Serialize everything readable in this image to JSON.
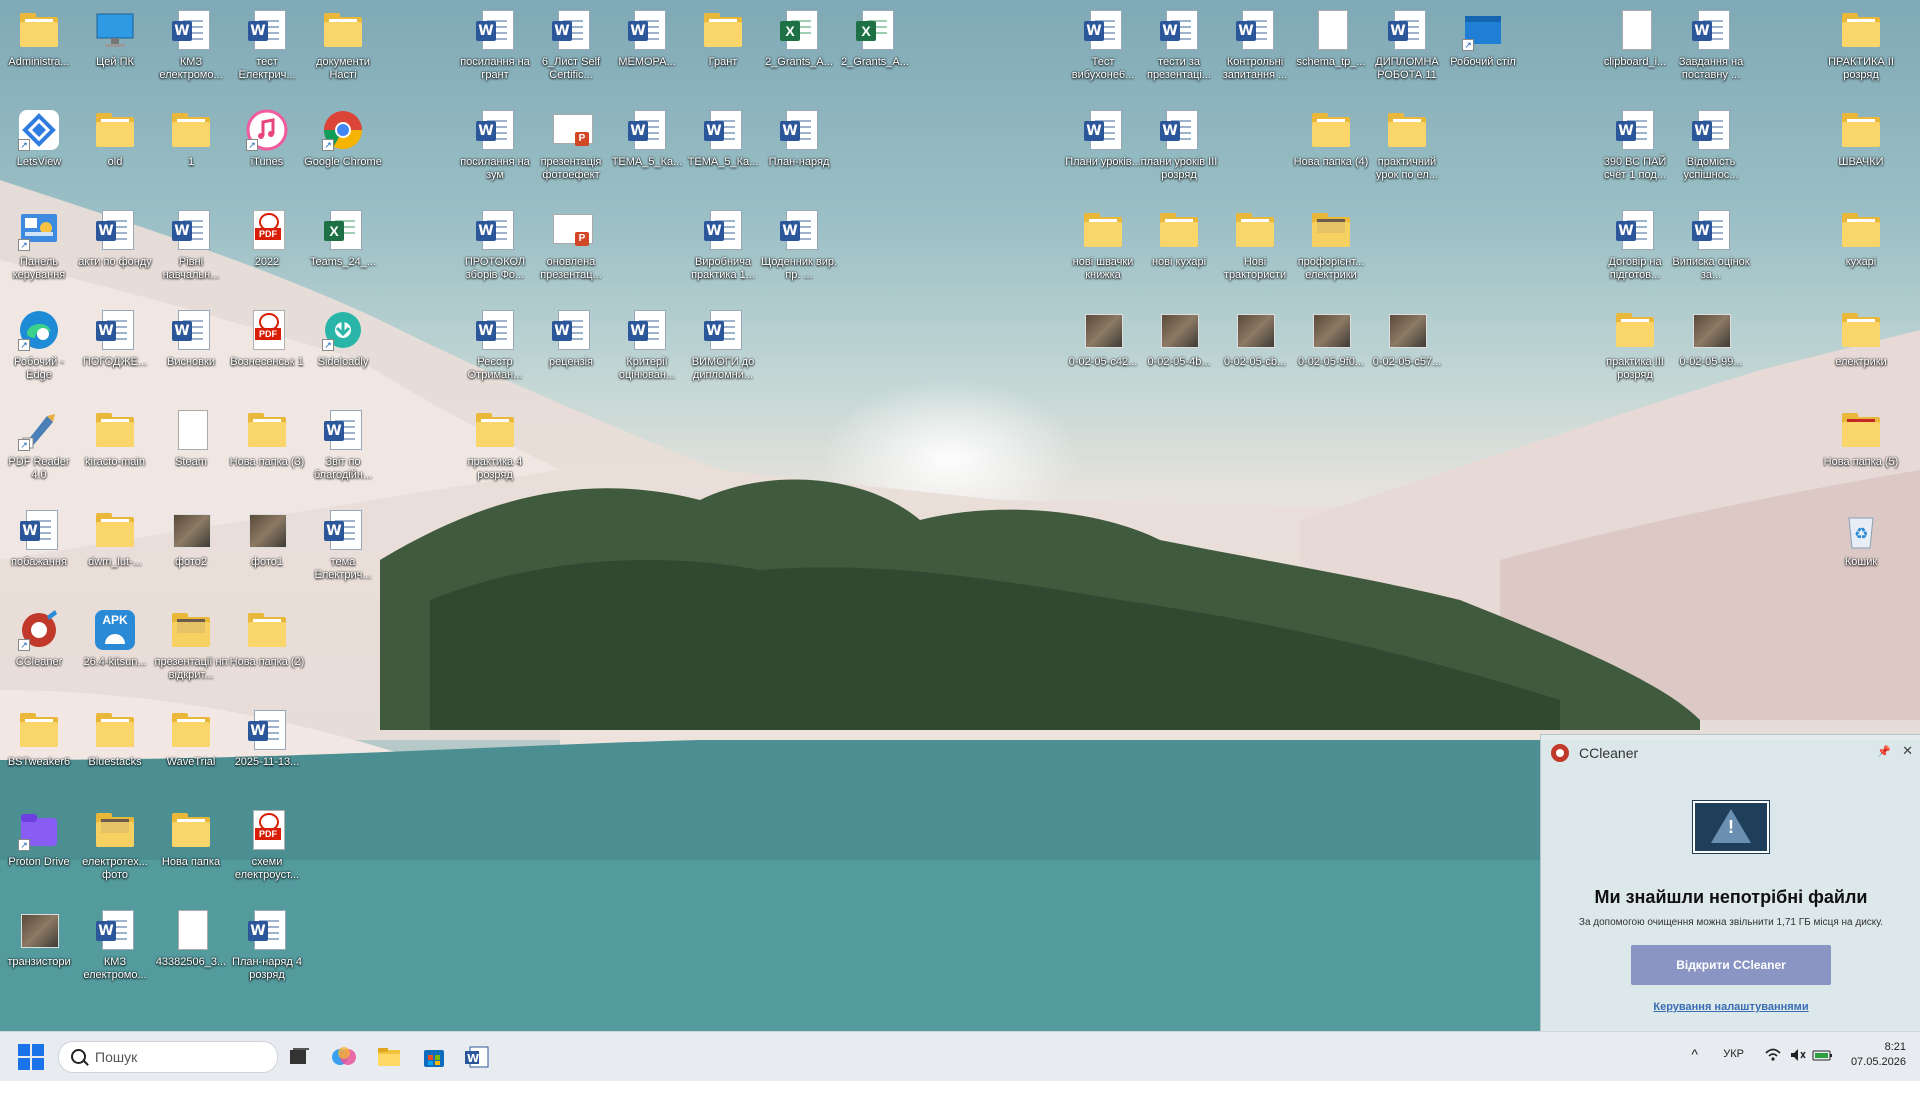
{
  "desktop": {
    "icons": [
      {
        "label": "Administra...",
        "type": "folder"
      },
      {
        "label": "Цей ПК",
        "type": "pc"
      },
      {
        "label": "КМЗ електромо...",
        "type": "word"
      },
      {
        "label": "тест Електрич...",
        "type": "word"
      },
      {
        "label": "документи Насті",
        "type": "folder"
      },
      {
        "label": "посилання на грант",
        "type": "word"
      },
      {
        "label": "6_Лист Self Certific...",
        "type": "word"
      },
      {
        "label": "МЕМОРА...",
        "type": "word"
      },
      {
        "label": "Грант",
        "type": "folder"
      },
      {
        "label": "2_Grants_A...",
        "type": "excel"
      },
      {
        "label": "2_Grants_A...",
        "type": "excel"
      },
      {
        "label": "Тест вибухоне6...",
        "type": "word"
      },
      {
        "label": "тести за презентаці...",
        "type": "word"
      },
      {
        "label": "Контрольні запитання ...",
        "type": "word"
      },
      {
        "label": "schema_tp_...",
        "type": "blank"
      },
      {
        "label": "ДИПЛОМНА РОБОТА.11",
        "type": "word"
      },
      {
        "label": "Робочий стіл",
        "type": "desktopfolder"
      },
      {
        "label": "clipboard_i...",
        "type": "blank"
      },
      {
        "label": "Завдання на поставну ...",
        "type": "word"
      },
      {
        "label": "ПРАКТИКА ІІ розряд",
        "type": "folder"
      },
      {
        "label": "LetsView",
        "type": "letsview"
      },
      {
        "label": "old",
        "type": "folder"
      },
      {
        "label": "1",
        "type": "folder"
      },
      {
        "label": "iTunes",
        "type": "itunes"
      },
      {
        "label": "Google Chrome",
        "type": "chrome"
      },
      {
        "label": "посилання на зум",
        "type": "word"
      },
      {
        "label": "презентація фотоефект",
        "type": "ppt"
      },
      {
        "label": "ТЕМА_5_Ка...",
        "type": "word"
      },
      {
        "label": "ТЕМА_5_Ка...",
        "type": "word"
      },
      {
        "label": "План-наряд",
        "type": "word"
      },
      {
        "label": "Плани уроків...",
        "type": "word"
      },
      {
        "label": "плани уроків ІІІ розряд",
        "type": "word"
      },
      {
        "label": "Нова папка (4)",
        "type": "folder"
      },
      {
        "label": "практичний урок по ел...",
        "type": "folder"
      },
      {
        "label": "390 ВС ПАЙ счёт 1 под...",
        "type": "word"
      },
      {
        "label": "Відомість успішнос...",
        "type": "word"
      },
      {
        "label": "ШВАЧКИ",
        "type": "folder"
      },
      {
        "label": "Панель керування",
        "type": "control"
      },
      {
        "label": "акти по фонду",
        "type": "word"
      },
      {
        "label": "Рівні навчальн...",
        "type": "word"
      },
      {
        "label": "2022",
        "type": "pdf"
      },
      {
        "label": "Teams_24_...",
        "type": "excel"
      },
      {
        "label": "ПРОТОКОЛ зборів Фо...",
        "type": "word"
      },
      {
        "label": "оновлена презентац...",
        "type": "ppt"
      },
      {
        "label": "Виробнича практика 1...",
        "type": "word"
      },
      {
        "label": "Щоденник вир. пр. ...",
        "type": "word"
      },
      {
        "label": "нові швачки книжка",
        "type": "folder"
      },
      {
        "label": "нові кухарі",
        "type": "folder"
      },
      {
        "label": "Нові трактористи",
        "type": "folder"
      },
      {
        "label": "профорієнт... електрики",
        "type": "photofolder"
      },
      {
        "label": "Договір на підготов...",
        "type": "word"
      },
      {
        "label": "Виписка оцінок за...",
        "type": "word"
      },
      {
        "label": "кухарі",
        "type": "folder"
      },
      {
        "label": "Робочий - Edge",
        "type": "edge"
      },
      {
        "label": "ПОГОДЖЕ...",
        "type": "word"
      },
      {
        "label": "Висновки",
        "type": "word"
      },
      {
        "label": "Вознесенськ 1",
        "type": "pdf"
      },
      {
        "label": "Sideloadly",
        "type": "sideloadly"
      },
      {
        "label": "Реєстр Отриман...",
        "type": "word"
      },
      {
        "label": "рецензія",
        "type": "word"
      },
      {
        "label": "Критерії оцінюван...",
        "type": "word"
      },
      {
        "label": "ВИМОГИ до дипломни...",
        "type": "word"
      },
      {
        "label": "0-02-05-c42...",
        "type": "photo"
      },
      {
        "label": "0-02-05-4b...",
        "type": "photo"
      },
      {
        "label": "0-02-05-cb...",
        "type": "photo"
      },
      {
        "label": "0-02-05-9f0...",
        "type": "photo"
      },
      {
        "label": "0-02-05-c57...",
        "type": "photo"
      },
      {
        "label": "практика ІІІ розряд",
        "type": "folder"
      },
      {
        "label": "0-02-05-99...",
        "type": "photo"
      },
      {
        "label": "електрики",
        "type": "folder"
      },
      {
        "label": "PDF Reader 4.0",
        "type": "pdfreader"
      },
      {
        "label": "kiracto-main",
        "type": "folder"
      },
      {
        "label": "Steam",
        "type": "blank"
      },
      {
        "label": "Нова папка (3)",
        "type": "folder"
      },
      {
        "label": "Звіт по благодійн...",
        "type": "word"
      },
      {
        "label": "практика 4 розряд",
        "type": "folder"
      },
      {
        "label": "Нова папка (5)",
        "type": "redfolder"
      },
      {
        "label": "побажання",
        "type": "word"
      },
      {
        "label": "dwm_lut-...",
        "type": "folder"
      },
      {
        "label": "фото2",
        "type": "photo"
      },
      {
        "label": "фото1",
        "type": "photo"
      },
      {
        "label": "тема Електрич...",
        "type": "word"
      },
      {
        "label": "Кошик",
        "type": "recycle"
      },
      {
        "label": "CCleaner",
        "type": "ccleaner"
      },
      {
        "label": "26.4-kitsun...",
        "type": "apk"
      },
      {
        "label": "презентації нп відкрит...",
        "type": "photofolder"
      },
      {
        "label": "Нова папка (2)",
        "type": "folder"
      },
      {
        "label": "BSTweaker6",
        "type": "folder"
      },
      {
        "label": "Bluestacks",
        "type": "folder"
      },
      {
        "label": "WaveTrial",
        "type": "folder"
      },
      {
        "label": "2025-11-13...",
        "type": "word"
      },
      {
        "label": "Proton Drive",
        "type": "proton"
      },
      {
        "label": "електротех... фото",
        "type": "photofolder"
      },
      {
        "label": "Нова папка",
        "type": "folder"
      },
      {
        "label": "схеми електроуст...",
        "type": "pdf"
      },
      {
        "label": "транзистори",
        "type": "photo"
      },
      {
        "label": "КМЗ електромо...",
        "type": "word"
      },
      {
        "label": "43382506_3...",
        "type": "blank"
      },
      {
        "label": "План-наряд 4 розряд",
        "type": "word"
      }
    ]
  },
  "ccleaner_popup": {
    "app_name": "CCleaner",
    "pin": "📌",
    "close": "✕",
    "warning_glyph": "!",
    "title": "Ми знайшли непотрібні файли",
    "subtitle": "За допомогою очищення можна звільнити 1,71 ГБ місця на диску.",
    "button": "Відкрити CCleaner",
    "link": "Керування налаштуваннями"
  },
  "taskbar": {
    "search_placeholder": "Пошук",
    "pinned": [
      "task-view-icon",
      "copilot-icon",
      "file-explorer-icon",
      "microsoft-store-icon",
      "word-icon"
    ],
    "tray_chevron": "^",
    "language": "УКР",
    "time": "8:21",
    "date": "07.05.2026"
  },
  "colors": {
    "folder": "#f9d56a",
    "word": "#2b579a",
    "excel": "#1e7145",
    "pdf": "#d81e05",
    "taskbar_bg": "#e8ecf0",
    "popup_button": "#8a95c4"
  }
}
